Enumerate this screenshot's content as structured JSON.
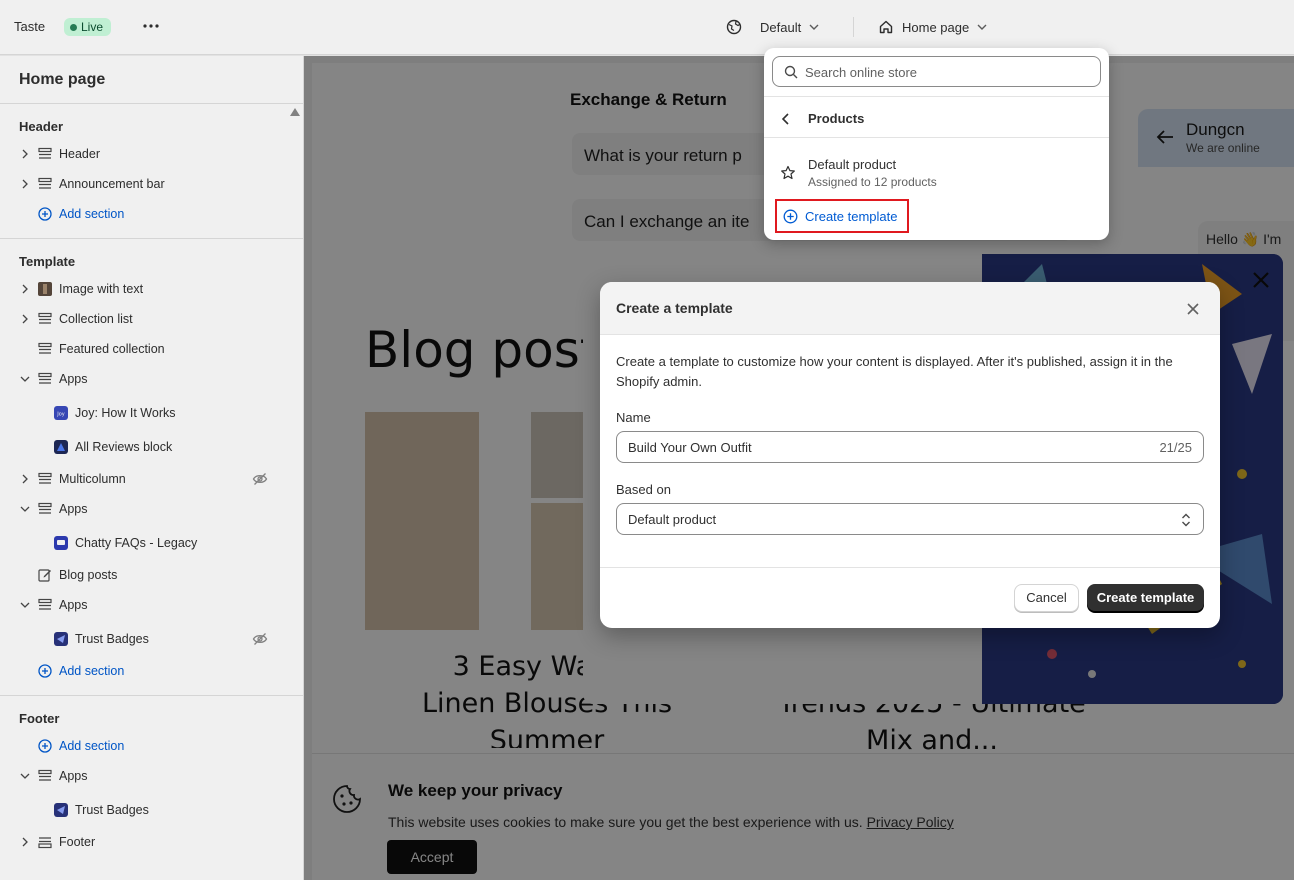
{
  "topbar": {
    "app_name": "Taste",
    "status_badge": "Live",
    "theme_selector": "Default",
    "page_selector": "Home page"
  },
  "sidebar": {
    "title": "Home page",
    "header_group": {
      "title": "Header",
      "items": [
        "Header",
        "Announcement bar"
      ],
      "add_section": "Add section"
    },
    "template_group": {
      "title": "Template",
      "items": {
        "image_with_text": "Image with text",
        "collection_list": "Collection list",
        "featured_collection": "Featured collection",
        "apps_1": "Apps",
        "joy": "Joy: How It Works",
        "all_reviews": "All Reviews block",
        "multicolumn": "Multicolumn",
        "apps_2": "Apps",
        "chatty": "Chatty FAQs - Legacy",
        "blog_posts": "Blog posts",
        "apps_3": "Apps",
        "trust_badges": "Trust Badges"
      },
      "add_section": "Add section"
    },
    "footer_group": {
      "title": "Footer",
      "add_section": "Add section",
      "items": {
        "apps": "Apps",
        "trust_badges": "Trust Badges",
        "footer": "Footer"
      }
    }
  },
  "preview": {
    "heading": "Exchange & Return",
    "faq_1": "What is your return p",
    "faq_2": "Can I exchange an ite",
    "blog_title": "Blog post",
    "article_1": "3 Easy Ways t\nLinen Blouses This\nSummer",
    "article_2": "Trends 2025 - Ultimate\nMix and...",
    "chat": {
      "name": "Dungcn",
      "status": "We are online",
      "message": "Hello 👋 I'm"
    },
    "cookie": {
      "title": "We keep your privacy",
      "text": "This website uses cookies to make sure you get the best experience with us.",
      "link": "Privacy Policy",
      "accept": "Accept"
    }
  },
  "dropdown": {
    "search_placeholder": "Search online store",
    "back_label": "Products",
    "option_name": "Default product",
    "option_sub": "Assigned to 12 products",
    "create_template": "Create template"
  },
  "modal": {
    "title": "Create a template",
    "description": "Create a template to customize how your content is displayed. After it's published, assign it in the Shopify admin.",
    "name_label": "Name",
    "name_value": "Build Your Own Outfit",
    "name_count": "21/25",
    "based_on_label": "Based on",
    "based_on_value": "Default product",
    "cancel": "Cancel",
    "create": "Create template"
  },
  "colors": {
    "accent": "#005bd3",
    "primary_button": "#303030",
    "live_badge_bg": "#cdfee1",
    "highlight_border": "#e0191f"
  }
}
